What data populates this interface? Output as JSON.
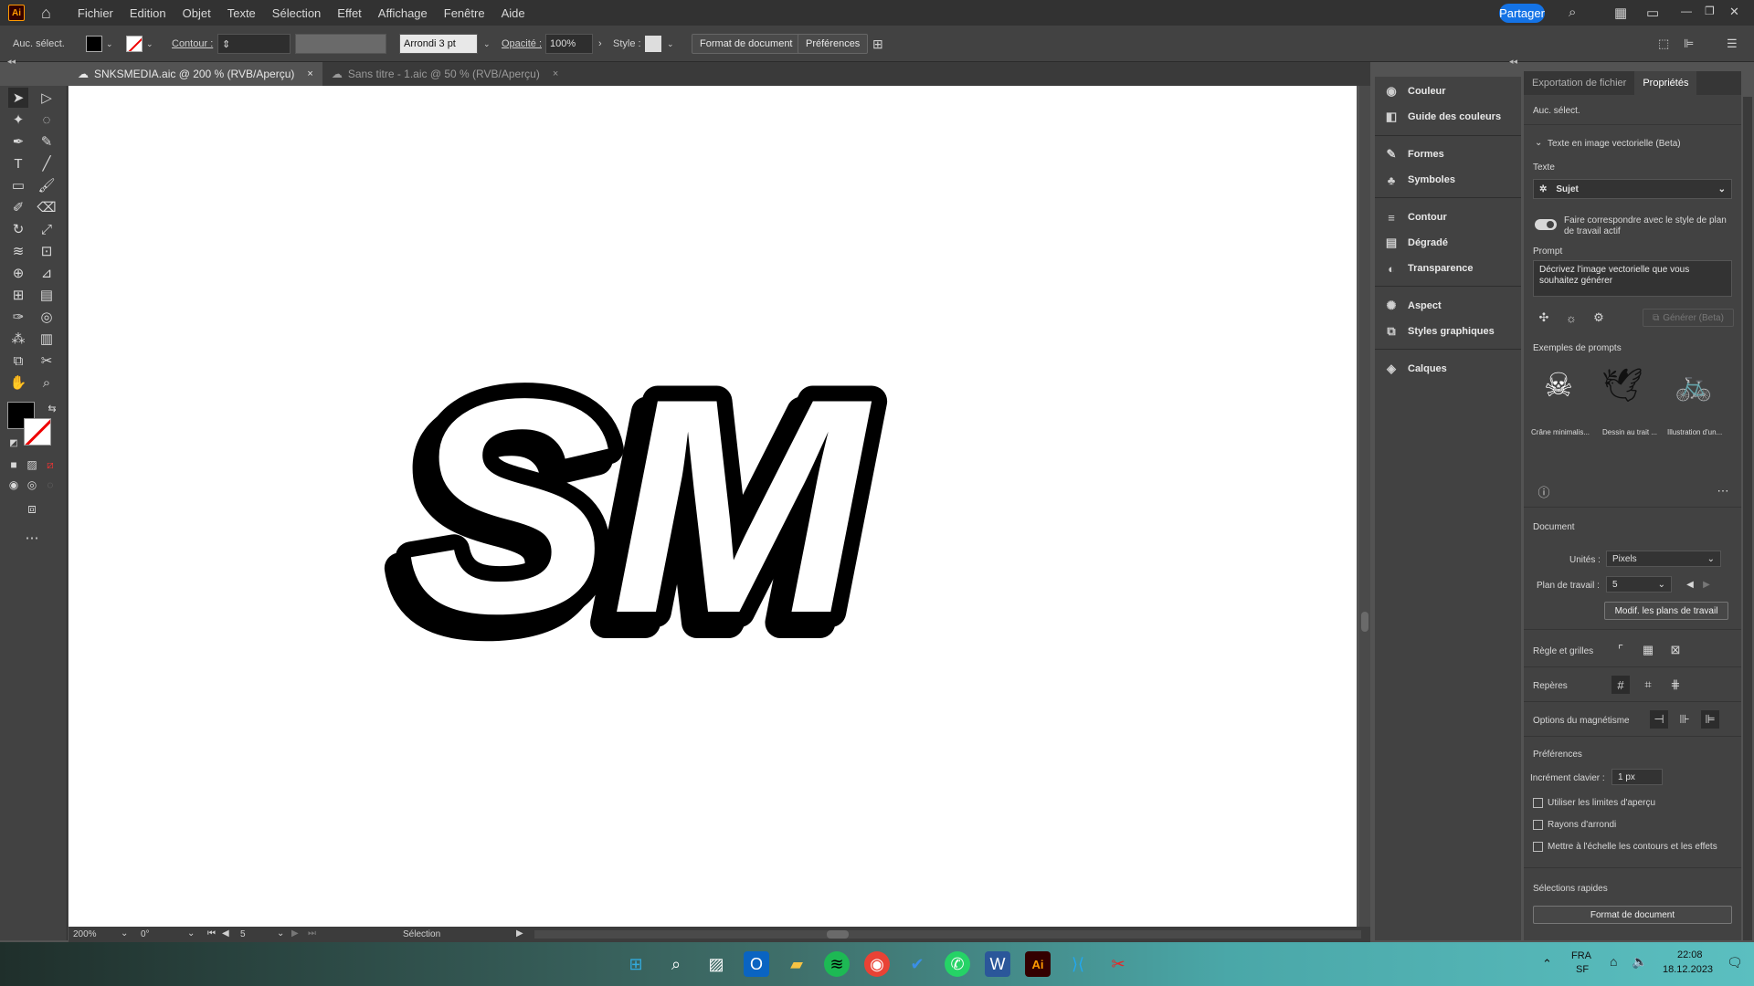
{
  "app": {
    "logo": "Ai"
  },
  "menu": [
    "Fichier",
    "Edition",
    "Objet",
    "Texte",
    "Sélection",
    "Effet",
    "Affichage",
    "Fenêtre",
    "Aide"
  ],
  "topbar": {
    "share_label": "Partager"
  },
  "control": {
    "selection": "Auc. sélect.",
    "stroke_label": "Contour :",
    "brush": "Arrondi 3 pt",
    "opacity_label": "Opacité :",
    "opacity_value": "100%",
    "style_label": "Style :",
    "doc_format_btn": "Format de document",
    "prefs_btn": "Préférences"
  },
  "tabs": [
    {
      "label": "SNKSMEDIA.aic @ 200 % (RVB/Aperçu)",
      "close": "×"
    },
    {
      "label": "Sans titre - 1.aic @ 50 % (RVB/Aperçu)",
      "close": "×"
    }
  ],
  "artwork": {
    "text": "SM"
  },
  "status": {
    "zoom": "200%",
    "rotation": "0°",
    "artboard": "5",
    "tool": "Sélection"
  },
  "mid_panels": [
    "Couleur",
    "Guide des couleurs",
    "Formes",
    "Symboles",
    "Contour",
    "Dégradé",
    "Transparence",
    "Aspect",
    "Styles graphiques",
    "Calques"
  ],
  "props": {
    "tab_export": "Exportation de fichier",
    "tab_props": "Propriétés",
    "no_selection": "Auc. sélect.",
    "text_to_vector": "Texte en image vectorielle (Beta)",
    "text_label": "Texte",
    "subject": "Sujet",
    "match_style": "Faire correspondre avec le style de plan de travail actif",
    "prompt_label": "Prompt",
    "prompt_placeholder": "Décrivez l'image vectorielle que vous souhaitez générer",
    "generate": "Générer (Beta)",
    "examples_label": "Exemples de prompts",
    "examples": [
      "Crâne minimalis...",
      "Dessin au trait ...",
      "Illustration d'un..."
    ],
    "document": "Document",
    "units_label": "Unités :",
    "units_value": "Pixels",
    "artboard_label": "Plan de travail :",
    "artboard_value": "5",
    "edit_artboards": "Modif. les plans de travail",
    "rulers_grids": "Règle et grilles",
    "guides": "Repères",
    "snap_options": "Options du magnétisme",
    "preferences": "Préférences",
    "keyboard_increment_label": "Incrément clavier :",
    "keyboard_increment_value": "1 px",
    "chk_preview_bounds": "Utiliser les limites d'aperçu",
    "chk_corners": "Rayons d'arrondi",
    "chk_scale_strokes": "Mettre à l'échelle les contours et les effets",
    "quick_select": "Sélections rapides",
    "doc_format": "Format de document"
  },
  "taskbar": {
    "lang1": "FRA",
    "lang2": "SF",
    "time": "22:08",
    "date": "18.12.2023"
  }
}
